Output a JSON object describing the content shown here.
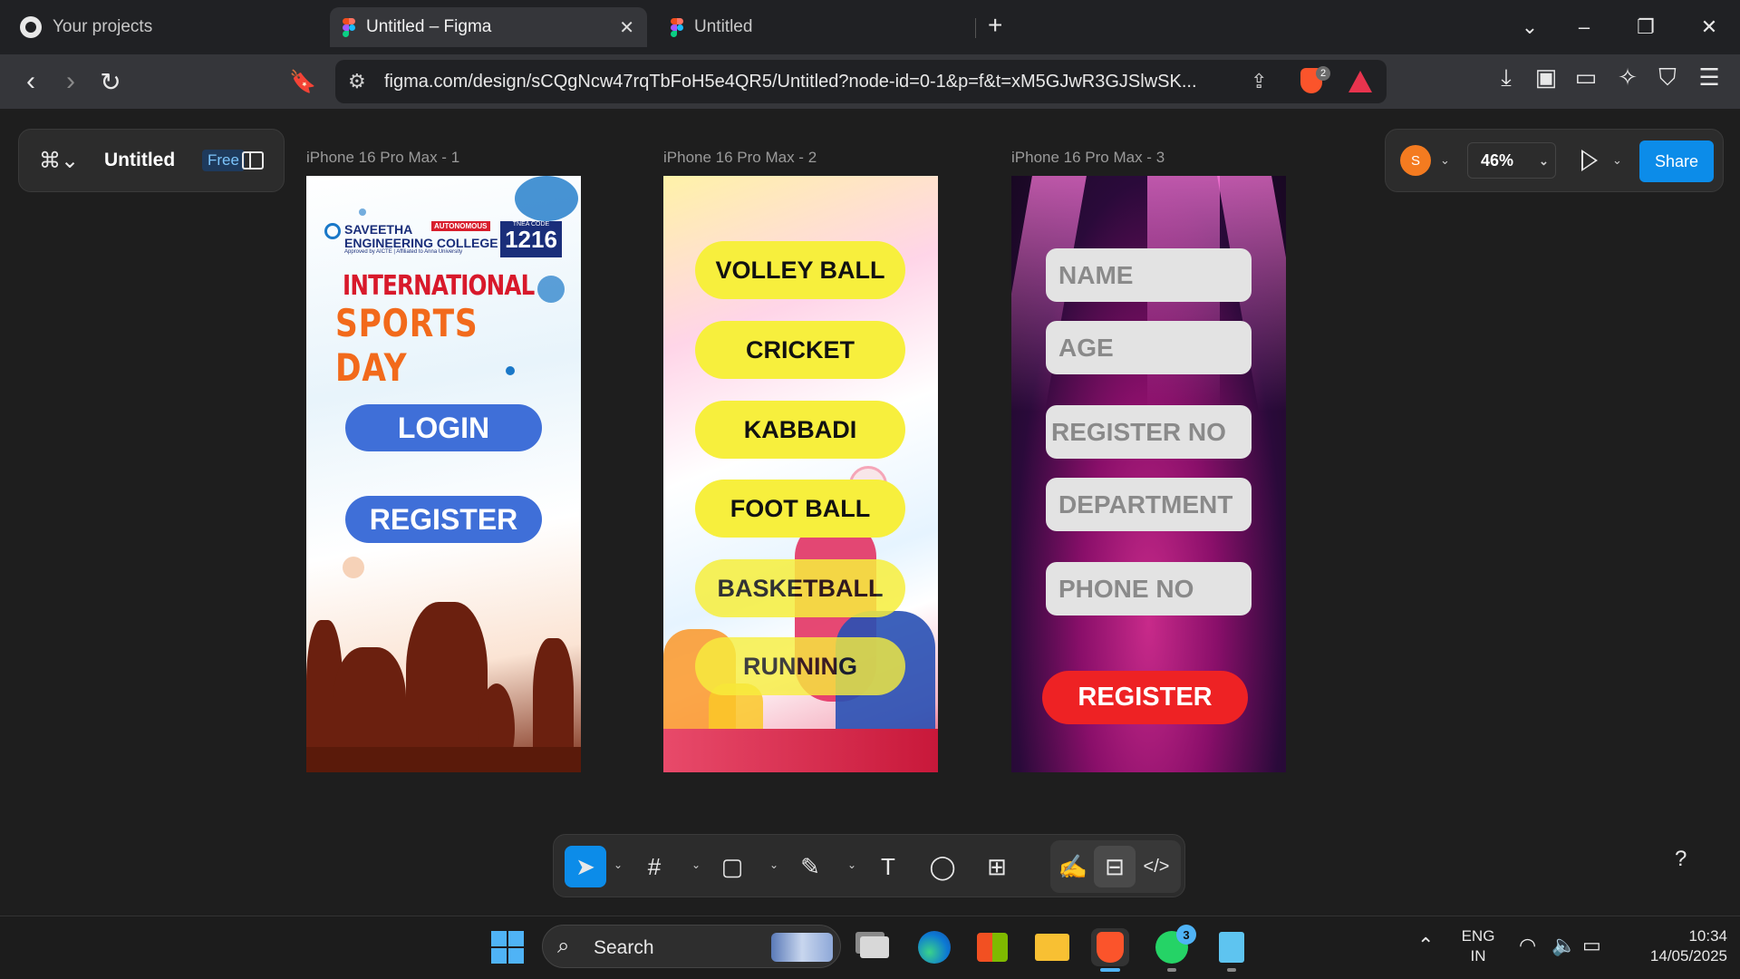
{
  "browser": {
    "tabs": [
      {
        "label": "Your projects"
      },
      {
        "label": "Untitled – Figma"
      },
      {
        "label": "Untitled"
      }
    ],
    "new_tab_symbol": "+",
    "url": "figma.com/design/sCQgNcw47rqTbFoH5e4QR5/Untitled?node-id=0-1&p=f&t=xM5GJwR3GJSlwSK...",
    "shield_badge_count": "2"
  },
  "figma": {
    "file_title": "Untitled",
    "plan_badge": "Free",
    "avatar_initial": "S",
    "zoom": "46%",
    "share_label": "Share",
    "help_symbol": "?",
    "frames": [
      {
        "label": "iPhone 16 Pro Max - 1",
        "college_line1": "SAVEETHA",
        "college_line2": "ENGINEERING COLLEGE",
        "college_sub": "Approved by AICTE | Affiliated to Anna University",
        "autonomous_tag": "AUTONOMOUS",
        "tnea_label": "TNEA CODE",
        "tnea_code": "1216",
        "title_line1": "INTERNATIONAL",
        "title_line2": "SPORTS DAY",
        "buttons": [
          "LOGIN",
          "REGISTER"
        ]
      },
      {
        "label": "iPhone 16 Pro Max - 2",
        "sports": [
          "VOLLEY BALL",
          "CRICKET",
          "KABBADI",
          "FOOT BALL",
          "BASKETBALL",
          "RUNNING"
        ]
      },
      {
        "label": "iPhone 16 Pro Max - 3",
        "fields": [
          "NAME",
          "AGE",
          "REGISTER NO",
          "DEPARTMENT",
          "PHONE NO"
        ],
        "submit_label": "REGISTER"
      }
    ]
  },
  "taskbar": {
    "search_label": "Search",
    "whatsapp_badge": "3",
    "lang_line1": "ENG",
    "lang_line2": "IN",
    "time": "10:34",
    "date": "14/05/2025"
  },
  "colors": {
    "figma_blue": "#0c8ce9",
    "login_blue": "#3f6fd8",
    "sport_yellow": "#f7ef3d",
    "register_red": "#ee2224"
  }
}
